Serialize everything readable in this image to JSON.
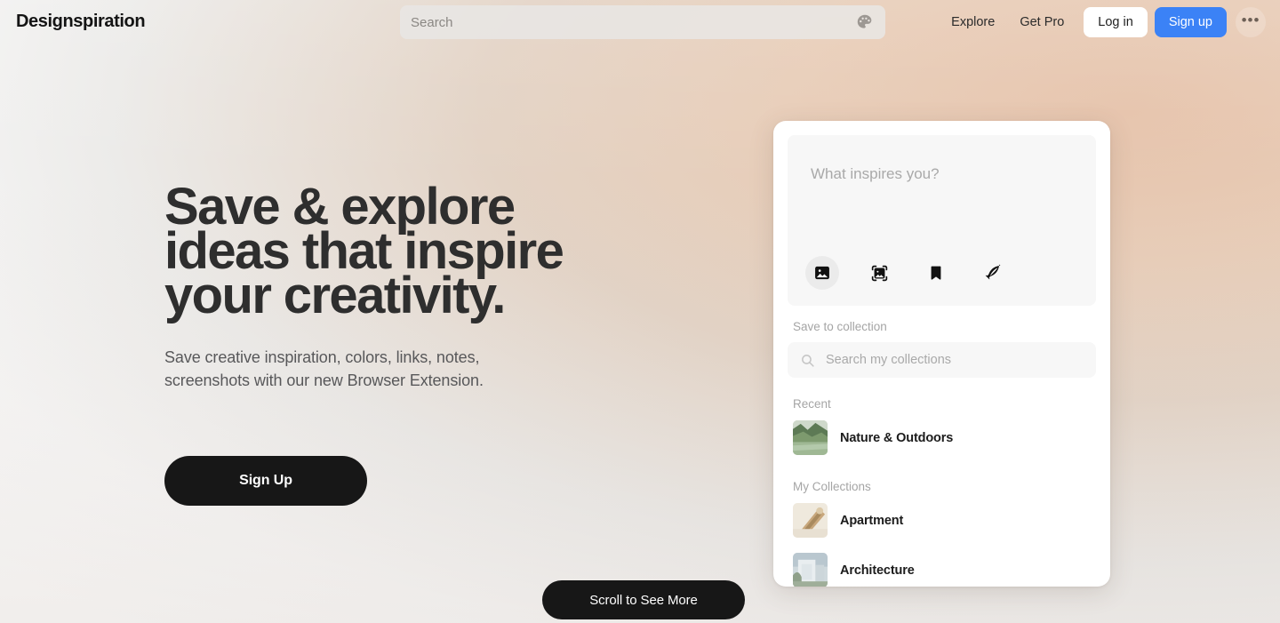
{
  "brand": {
    "name": "Designspiration"
  },
  "header": {
    "search": {
      "placeholder": "Search",
      "value": "",
      "palette_icon": "palette-icon"
    },
    "links": [
      {
        "label": "Explore",
        "name": "explore"
      },
      {
        "label": "Get Pro",
        "name": "get-pro"
      }
    ],
    "login_label": "Log in",
    "signup_label": "Sign up",
    "more_label": "•••",
    "signup_color": "#3b82f6"
  },
  "hero": {
    "headline": "Save & explore\nideas that inspire\nyour creativity.",
    "subhead": "Save creative inspiration, colors, links, notes,\nscreenshots with our new Browser Extension.",
    "cta_label": "Sign Up",
    "scroll_label": "Scroll to See More"
  },
  "panel": {
    "compose_placeholder": "What inspires you?",
    "tools": [
      {
        "name": "image-icon",
        "label": "Image",
        "active": true
      },
      {
        "name": "screenshot-icon",
        "label": "Screenshot",
        "active": false
      },
      {
        "name": "bookmark-icon",
        "label": "Bookmark",
        "active": false
      },
      {
        "name": "quill-icon",
        "label": "Note",
        "active": false
      }
    ],
    "save_to_collection_label": "Save to collection",
    "collections_search_placeholder": "Search my collections",
    "collections_search_value": "",
    "groups": [
      {
        "label": "Recent",
        "items": [
          {
            "name": "Nature & Outdoors",
            "thumb_colors": [
              "#7d9a6e",
              "#b9c9ae",
              "#5d7a55",
              "#9fb894"
            ]
          }
        ]
      },
      {
        "label": "My Collections",
        "items": [
          {
            "name": "Apartment",
            "thumb_colors": [
              "#e8e0d2",
              "#c8a77c",
              "#a98a5e",
              "#efe9dd"
            ]
          },
          {
            "name": "Architecture",
            "thumb_colors": [
              "#b9c7cf",
              "#e9eef0",
              "#8fa08a",
              "#cfd9dd"
            ]
          }
        ]
      }
    ]
  }
}
